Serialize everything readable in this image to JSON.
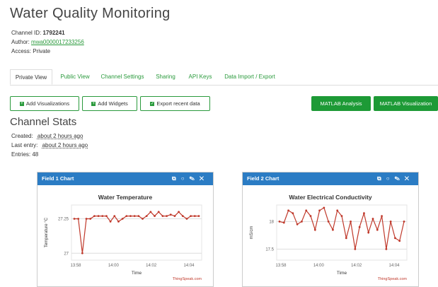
{
  "page": {
    "title": "Water Quality Monitoring",
    "channel_id_label": "Channel ID:",
    "channel_id": "1792241",
    "author_label": "Author:",
    "author": "mwa0000017233256",
    "access": "Access: Private"
  },
  "tabs": [
    {
      "label": "Private View",
      "active": true
    },
    {
      "label": "Public View"
    },
    {
      "label": "Channel Settings"
    },
    {
      "label": "Sharing"
    },
    {
      "label": "API Keys"
    },
    {
      "label": "Data Import / Export"
    }
  ],
  "actions": {
    "add_vis": "Add Visualizations",
    "add_widgets": "Add Widgets",
    "export": "Export recent data",
    "matlab_analysis": "MATLAB Analysis",
    "matlab_vis": "MATLAB Visualization"
  },
  "stats": {
    "heading": "Channel Stats",
    "created_label": "Created:",
    "created": "about 2 hours ago",
    "last_label": "Last entry:",
    "last": "about 2 hours ago",
    "entries": "Entries: 48"
  },
  "panels": [
    {
      "header": "Field 1 Chart"
    },
    {
      "header": "Field 2 Chart"
    }
  ],
  "colors": {
    "brand_green": "#2a9a3c",
    "panel_blue": "#2b7cc4",
    "line_red": "#c0392b"
  },
  "chart_data": [
    {
      "type": "line",
      "title": "Water Temperature",
      "xlabel": "Time",
      "ylabel": "Temperature °C",
      "credit": "ThingSpeak.com",
      "xticks": [
        "13:58",
        "14:00",
        "14:02",
        "14:04"
      ],
      "yticks": [
        "27.25",
        "27"
      ],
      "ylim": [
        26.95,
        27.35
      ],
      "values": [
        27.25,
        27.25,
        27.0,
        27.25,
        27.25,
        27.27,
        27.27,
        27.27,
        27.27,
        27.23,
        27.27,
        27.23,
        27.25,
        27.27,
        27.27,
        27.27,
        27.27,
        27.25,
        27.27,
        27.3,
        27.27,
        27.3,
        27.27,
        27.27,
        27.28,
        27.27,
        27.3,
        27.27,
        27.25,
        27.27,
        27.27,
        27.27
      ]
    },
    {
      "type": "line",
      "title": "Water Electrical Conductivity",
      "xlabel": "Time",
      "ylabel": "mS/cm",
      "credit": "ThingSpeak.com",
      "xticks": [
        "13:58",
        "14:00",
        "14:02",
        "14:04"
      ],
      "yticks": [
        "18",
        "17.5"
      ],
      "ylim": [
        17.3,
        18.3
      ],
      "values": [
        18.0,
        17.98,
        18.2,
        18.15,
        17.95,
        18.0,
        18.2,
        18.1,
        17.85,
        18.2,
        18.25,
        18.0,
        17.85,
        18.2,
        18.1,
        17.7,
        18.0,
        17.5,
        17.9,
        18.15,
        17.8,
        18.05,
        17.85,
        18.1,
        17.5,
        18.0,
        17.7,
        17.65,
        18.0
      ]
    }
  ]
}
